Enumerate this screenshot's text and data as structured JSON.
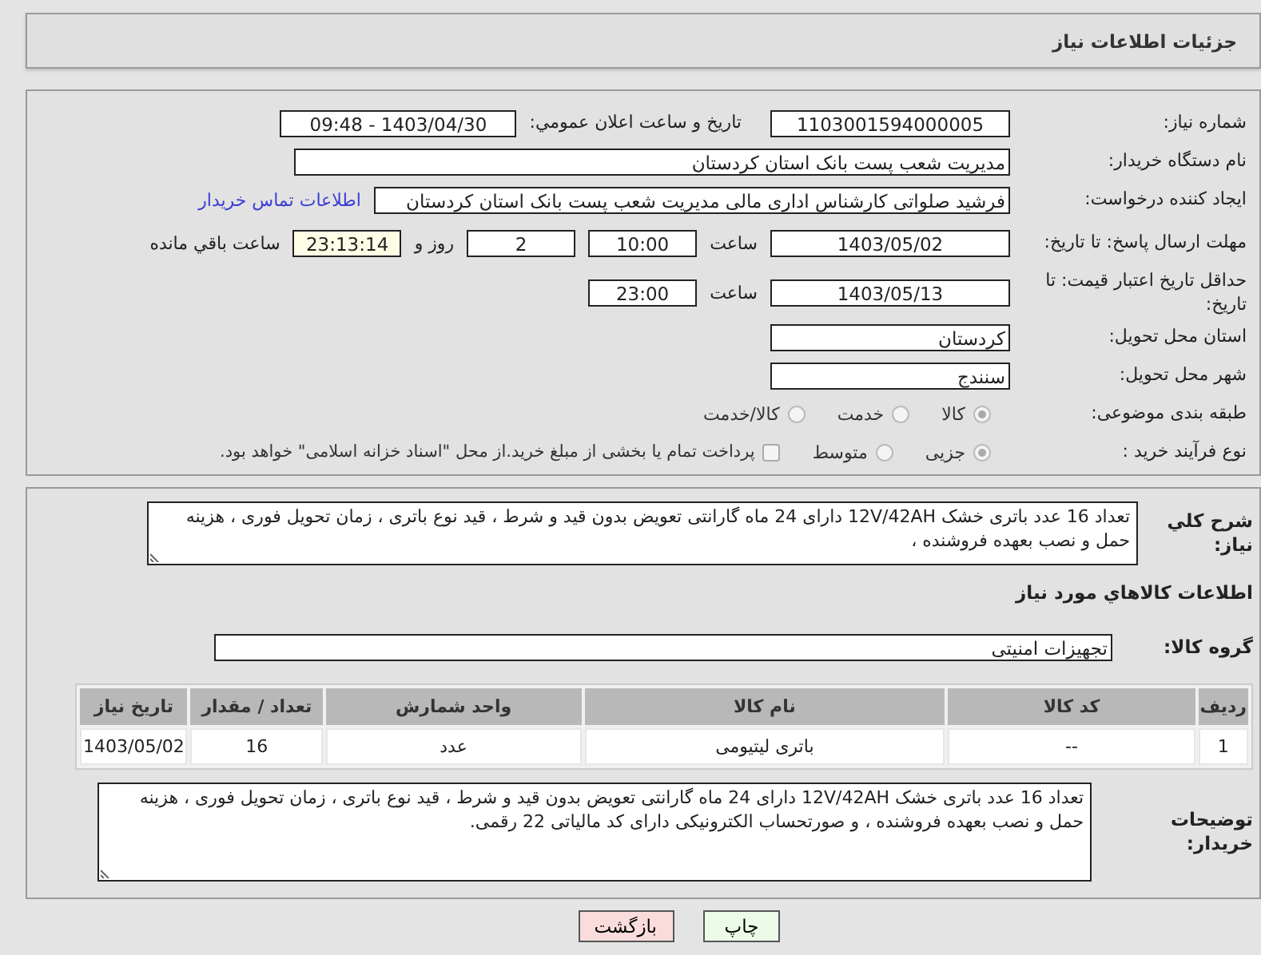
{
  "header": {
    "title": "جزئیات اطلاعات نیاز"
  },
  "need_number": {
    "label": "شماره نیاز:",
    "value": "1103001594000005"
  },
  "announce": {
    "label": "تاریخ و ساعت اعلان عمومي:",
    "value": "1403/04/30 - 09:48"
  },
  "buyer_org": {
    "label": "نام دستگاه خریدار:",
    "value": "مدیریت شعب پست بانک استان کردستان"
  },
  "requester": {
    "label": "ایجاد کننده درخواست:",
    "value": "فرشید صلواتی کارشناس اداری مالی مدیریت شعب پست بانک استان کردستان",
    "link": "اطلاعات تماس خریدار"
  },
  "reply_deadline": {
    "label": "مهلت ارسال پاسخ: تا تاریخ:",
    "date": "1403/05/02",
    "time_label": "ساعت",
    "time": "10:00",
    "days": "2",
    "days_label": "روز و",
    "remaining": "23:13:14",
    "remaining_label": "ساعت باقي مانده"
  },
  "price_validity": {
    "label": "حداقل تاریخ اعتبار قیمت: تا تاریخ:",
    "date": "1403/05/13",
    "time_label": "ساعت",
    "time": "23:00"
  },
  "province": {
    "label": "استان محل تحویل:",
    "value": "کردستان"
  },
  "city": {
    "label": "شهر محل تحویل:",
    "value": "سنندج"
  },
  "category": {
    "label": "طبقه بندی موضوعی:",
    "options": [
      {
        "label": "کالا",
        "selected": true
      },
      {
        "label": "خدمت",
        "selected": false
      },
      {
        "label": "کالا/خدمت",
        "selected": false
      }
    ]
  },
  "process": {
    "label": "نوع فرآیند خرید :",
    "options": [
      {
        "label": "جزیی",
        "selected": true
      },
      {
        "label": "متوسط",
        "selected": false
      }
    ],
    "treasury": {
      "label": "پرداخت تمام یا بخشی از مبلغ خرید.از محل \"اسناد خزانه اسلامی\" خواهد بود.",
      "checked": false
    }
  },
  "summary": {
    "label": "شرح کلي نیاز:",
    "value": "تعداد 16 عدد باتری خشک 12V/42AH  دارای 24 ماه  گارانتی  تعویض بدون قید و شرط ، قید نوع باتری ، زمان تحویل فوری ، هزینه حمل و نصب بعهده فروشنده ،"
  },
  "goods_title": "اطلاعات کالاهاي مورد نیاز",
  "group": {
    "label": "گروه کالا:",
    "value": "تجهیزات امنیتی"
  },
  "table": {
    "columns": [
      "ردیف",
      "کد کالا",
      "نام کالا",
      "واحد شمارش",
      "تعداد / مقدار",
      "تاریخ نیاز"
    ],
    "rows": [
      [
        "1",
        "--",
        "باتری لیتیومی",
        "عدد",
        "16",
        "1403/05/02"
      ]
    ]
  },
  "buyer_notes": {
    "label": "توضیحات خریدار:",
    "value": "تعداد 16 عدد باتری خشک 12V/42AH  دارای 24 ماه  گارانتی  تعویض بدون قید و شرط ، قید نوع باتری ، زمان تحویل فوری ، هزینه حمل و نصب بعهده فروشنده ، و صورتحساب الکترونیکی دارای کد مالیاتی 22 رقمی."
  },
  "buttons": [
    {
      "label": "چاپ",
      "kind": "print"
    },
    {
      "label": "بازگشت",
      "kind": "back"
    }
  ]
}
